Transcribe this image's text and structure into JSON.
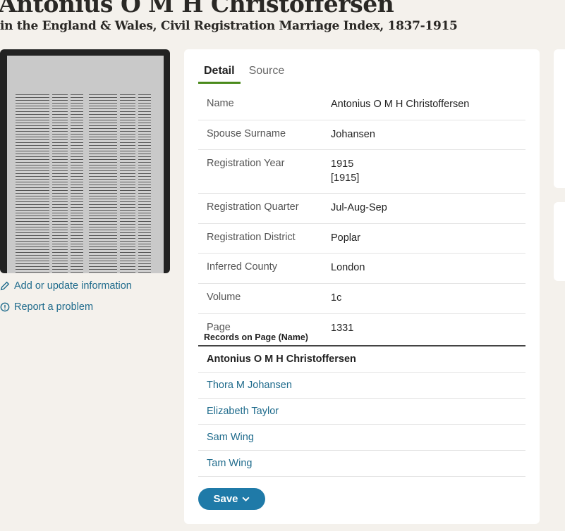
{
  "header": {
    "title": "Antonius O M H Christoffersen",
    "subtitle": "in the England & Wales, Civil Registration Marriage Index, 1837-1915"
  },
  "sidebar": {
    "add_update": "Add or update information",
    "report": "Report a problem"
  },
  "tabs": [
    "Detail",
    "Source"
  ],
  "details": [
    {
      "label": "Name",
      "value": "Antonius O M H Christoffersen"
    },
    {
      "label": "Spouse Surname",
      "value": "Johansen"
    },
    {
      "label": "Registration Year",
      "value": "1915",
      "value2": "[1915]"
    },
    {
      "label": "Registration Quarter",
      "value": "Jul-Aug-Sep"
    },
    {
      "label": "Registration District",
      "value": "Poplar"
    },
    {
      "label": "Inferred County",
      "value": "London"
    },
    {
      "label": "Volume",
      "value": "1c"
    },
    {
      "label": "Page",
      "value": "1331"
    }
  ],
  "records": {
    "header": "Records on Page (Name)",
    "items": [
      "Antonius O M H Christoffersen",
      "Thora M Johansen",
      "Elizabeth Taylor",
      "Sam Wing",
      "Tam Wing"
    ]
  },
  "save_label": "Save",
  "colors": {
    "link": "#1f6b8c",
    "tab_accent": "#4a8a1c",
    "save_button": "#1f7aa8",
    "background": "#f4f1ec"
  }
}
